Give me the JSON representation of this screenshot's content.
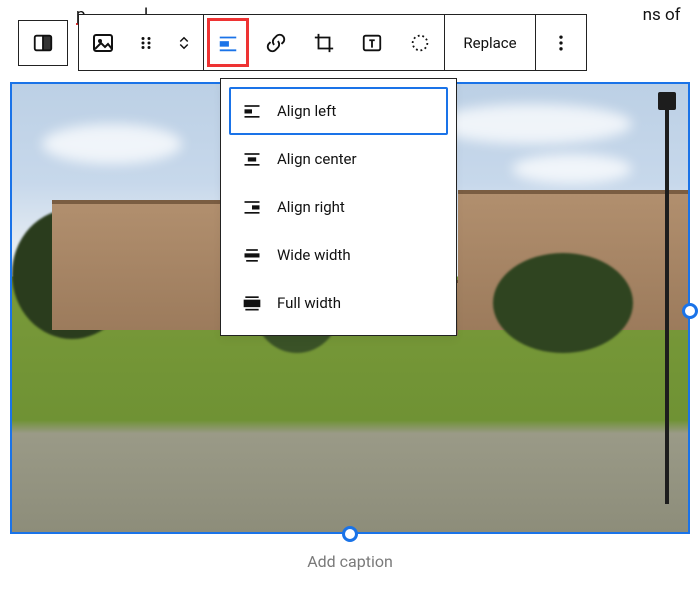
{
  "bg_text": {
    "line1_a": "p",
    "line1_b": "l",
    "line1_tail": "ns of"
  },
  "toolbar": {
    "replace_label": "Replace"
  },
  "align_menu": {
    "items": [
      {
        "label": "Align left",
        "selected": true
      },
      {
        "label": "Align center",
        "selected": false
      },
      {
        "label": "Align right",
        "selected": false
      },
      {
        "label": "Wide width",
        "selected": false
      },
      {
        "label": "Full width",
        "selected": false
      }
    ]
  },
  "caption_placeholder": "Add caption"
}
